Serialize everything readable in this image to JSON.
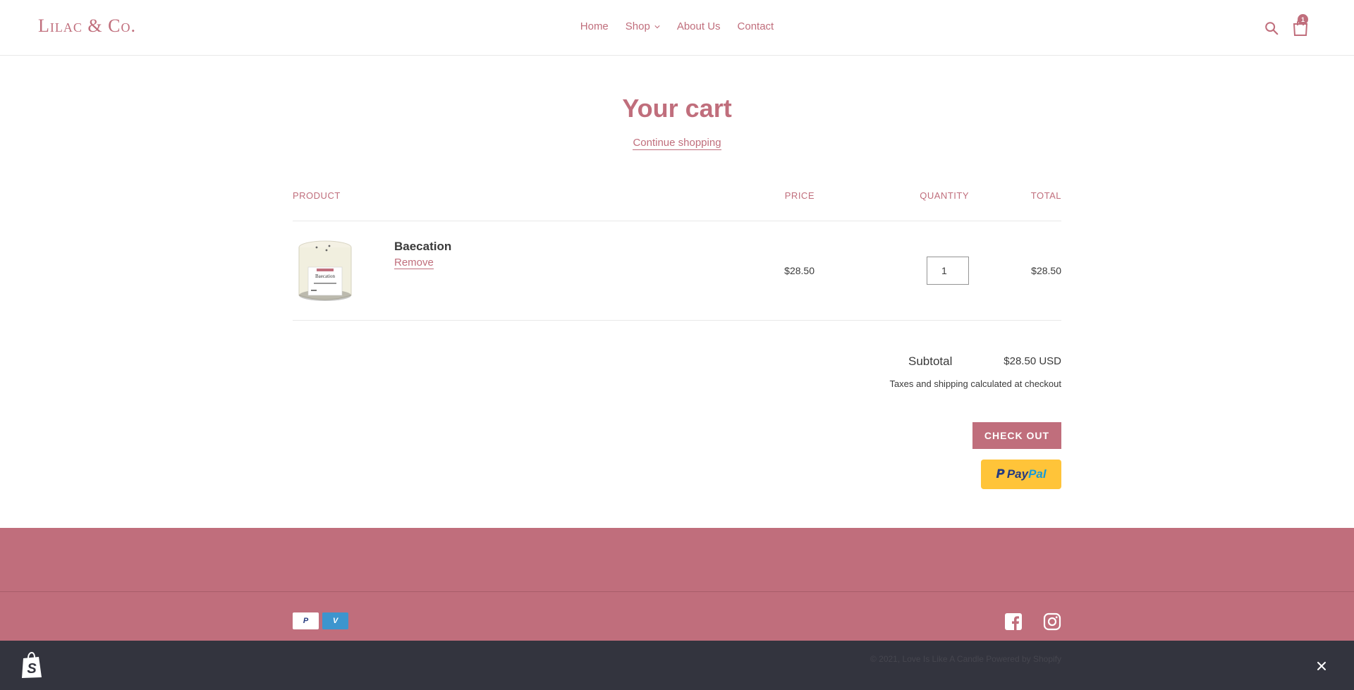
{
  "header": {
    "logo": "Lilac & Co.",
    "nav": {
      "home": "Home",
      "shop": "Shop",
      "about": "About Us",
      "contact": "Contact"
    },
    "cart_count": "1"
  },
  "cart": {
    "title": "Your cart",
    "continue_label": "Continue shopping",
    "columns": {
      "product": "Product",
      "price": "Price",
      "quantity": "Quantity",
      "total": "Total"
    },
    "items": [
      {
        "name": "Baecation",
        "remove_label": "Remove",
        "price": "$28.50",
        "quantity": "1",
        "total": "$28.50",
        "image_label": "Baecation"
      }
    ],
    "subtotal_label": "Subtotal",
    "subtotal_value": "$28.50 USD",
    "tax_note": "Taxes and shipping calculated at checkout",
    "checkout_label": "Check out",
    "paypal": {
      "p1": "Pay",
      "p2": "Pal"
    }
  },
  "footer": {
    "payment_icons": [
      "paypal",
      "venmo"
    ],
    "copyright": "© 2021, Love Is Like A Candle Powered by Shopify"
  },
  "colors": {
    "accent": "#c06e7c",
    "footer_bar": "#33343e",
    "paypal_yellow": "#ffc439"
  }
}
